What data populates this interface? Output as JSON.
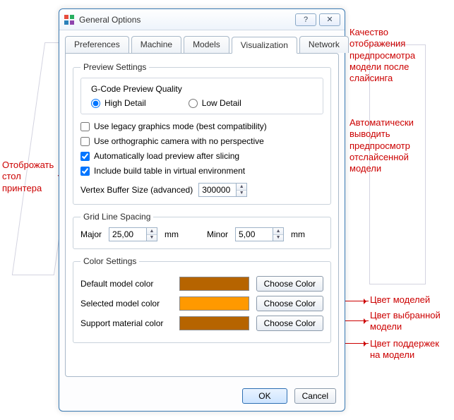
{
  "window": {
    "title": "General Options",
    "help": "?",
    "close": "✕"
  },
  "tabs": [
    "Preferences",
    "Machine",
    "Models",
    "Visualization",
    "Network"
  ],
  "active_tab": 3,
  "preview": {
    "legend": "Preview Settings",
    "quality_title": "G-Code Preview Quality",
    "high": "High Detail",
    "low": "Low Detail",
    "chk_legacy": "Use legacy graphics mode (best compatibility)",
    "chk_ortho": "Use orthographic camera with no perspective",
    "chk_autoload": "Automatically load preview after slicing",
    "chk_table": "Include build table in virtual environment",
    "vbs_label": "Vertex Buffer Size (advanced)",
    "vbs_value": "300000"
  },
  "grid": {
    "legend": "Grid Line Spacing",
    "major_label": "Major",
    "major_value": "25,00",
    "minor_label": "Minor",
    "minor_value": "5,00",
    "unit": "mm"
  },
  "colors": {
    "legend": "Color Settings",
    "default_label": "Default model color",
    "default_hex": "#b66400",
    "selected_label": "Selected model color",
    "selected_hex": "#ff9900",
    "support_label": "Support material color",
    "support_hex": "#b66400",
    "choose": "Choose Color"
  },
  "buttons": {
    "ok": "OK",
    "cancel": "Cancel"
  },
  "annotations": {
    "a1": "Качество\nотображения\nпредпросмотра\nмодели после\nслайсинга",
    "a2": "Автоматически\nвыводить\nпредпросмотр\nотслайсенной\nмодели",
    "a3": "Отоброжать\nстол\nпринтера",
    "a4": "Цвет моделей",
    "a5": "Цвет выбранной\nмодели",
    "a6": "Цвет поддержек\nна модели"
  }
}
